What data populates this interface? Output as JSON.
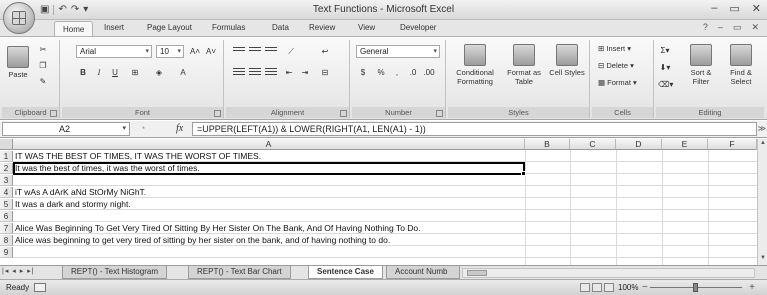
{
  "window": {
    "title": "Text Functions - Microsoft Excel",
    "minimize": "–",
    "restore": "▭",
    "close": "✕"
  },
  "ribbon_tabs": [
    "Home",
    "Insert",
    "Page Layout",
    "Formulas",
    "Data",
    "Review",
    "View",
    "Developer"
  ],
  "ribbon": {
    "clipboard": {
      "label": "Clipboard",
      "paste": "Paste"
    },
    "font": {
      "label": "Font",
      "name": "Arial",
      "size": "10",
      "grow": "A˄",
      "shrink": "A˅",
      "bold": "B",
      "italic": "I",
      "underline": "U"
    },
    "alignment": {
      "label": "Alignment"
    },
    "number": {
      "label": "Number",
      "format": "General",
      "currency": "$",
      "percent": "%",
      "comma": ",",
      "inc_decimal": ".0",
      "dec_decimal": ".00"
    },
    "styles": {
      "label": "Styles",
      "conditional": "Conditional Formatting",
      "format_table": "Format as Table",
      "cell_styles": "Cell Styles"
    },
    "cells": {
      "label": "Cells",
      "insert": "Insert",
      "delete": "Delete",
      "format": "Format"
    },
    "editing": {
      "label": "Editing",
      "sort": "Sort & Filter",
      "find": "Find & Select"
    }
  },
  "formula_bar": {
    "name_box": "A2",
    "fx": "fx",
    "formula": "=UPPER(LEFT(A1)) & LOWER(RIGHT(A1, LEN(A1) - 1))"
  },
  "columns": [
    "A",
    "B",
    "C",
    "D",
    "E",
    "F"
  ],
  "rows": [
    {
      "num": "1",
      "a": "IT WAS THE BEST OF TIMES, IT WAS THE WORST OF TIMES."
    },
    {
      "num": "2",
      "a": "It was the best of times, it was the worst of times."
    },
    {
      "num": "3",
      "a": ""
    },
    {
      "num": "4",
      "a": "iT wAs A dArK aNd StOrMy NiGhT."
    },
    {
      "num": "5",
      "a": "It was a dark and stormy night."
    },
    {
      "num": "6",
      "a": ""
    },
    {
      "num": "7",
      "a": "Alice Was Beginning To Get Very Tired Of Sitting By Her Sister On The Bank, And Of Having Nothing To Do."
    },
    {
      "num": "8",
      "a": "Alice was beginning to get very tired of sitting by her sister on the bank, and of having nothing to do."
    },
    {
      "num": "9",
      "a": ""
    }
  ],
  "sheet_tabs": [
    "REPT() - Text Histogram",
    "REPT() - Text Bar Chart",
    "Sentence Case",
    "Account Numb"
  ],
  "active_sheet": "Sentence Case",
  "status": {
    "ready": "Ready",
    "zoom": "100%"
  }
}
